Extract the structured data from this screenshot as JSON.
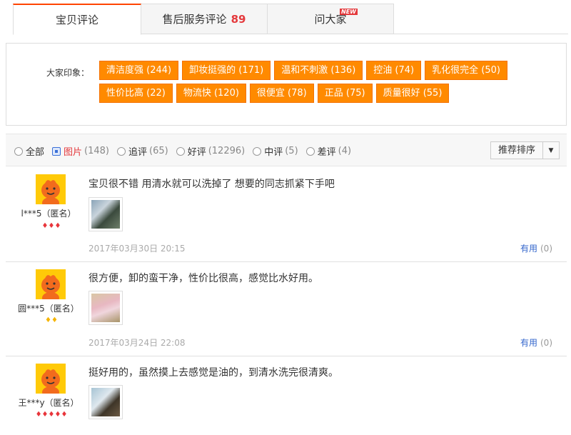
{
  "tabs": [
    {
      "label": "宝贝评论",
      "active": true
    },
    {
      "label": "售后服务评论",
      "count": "89"
    },
    {
      "label": "问大家",
      "badge": "NEW"
    }
  ],
  "impressions": {
    "label": "大家印象：",
    "row1": [
      "清洁度强 (244)",
      "卸妆挺强的 (171)",
      "温和不刺激 (136)",
      "控油 (74)",
      "乳化很完全 (50)"
    ],
    "row2": [
      "性价比高 (22)",
      "物流快 (120)",
      "很便宜 (78)",
      "正品 (75)",
      "质量很好 (55)"
    ]
  },
  "filter": {
    "options": [
      {
        "label": "全部",
        "count": ""
      },
      {
        "label": "图片",
        "count": "(148)",
        "selected": true
      },
      {
        "label": "追评",
        "count": "(65)"
      },
      {
        "label": "好评",
        "count": "(12296)"
      },
      {
        "label": "中评",
        "count": "(5)"
      },
      {
        "label": "差评",
        "count": "(4)"
      }
    ],
    "sort_label": "推荐排序",
    "sort_arrow": "▼"
  },
  "reviews": [
    {
      "user": "l***5（匿名）",
      "gems": "♦♦♦",
      "gem_color": "red",
      "text": "宝贝很不错 用清水就可以洗掉了 想要的同志抓紧下手吧",
      "date": "2017年03月30日 20:15",
      "useful": "有用",
      "useful_count": "(0)"
    },
    {
      "user": "圆***5（匿名）",
      "gems": "♦♦",
      "gem_color": "yellow",
      "text": "很方便，卸的蛮干净，性价比很高，感觉比水好用。",
      "date": "2017年03月24日 22:08",
      "useful": "有用",
      "useful_count": "(0)"
    },
    {
      "user": "王***y（匿名）",
      "gems": "♦♦♦♦♦",
      "gem_color": "red",
      "text": "挺好用的，虽然摸上去感觉是油的，到清水洗完很清爽。",
      "date": "",
      "useful": "",
      "useful_count": ""
    }
  ],
  "colors": {
    "accent": "#ff8a00",
    "price_red": "#e4393c",
    "link_blue": "#3366cc"
  }
}
